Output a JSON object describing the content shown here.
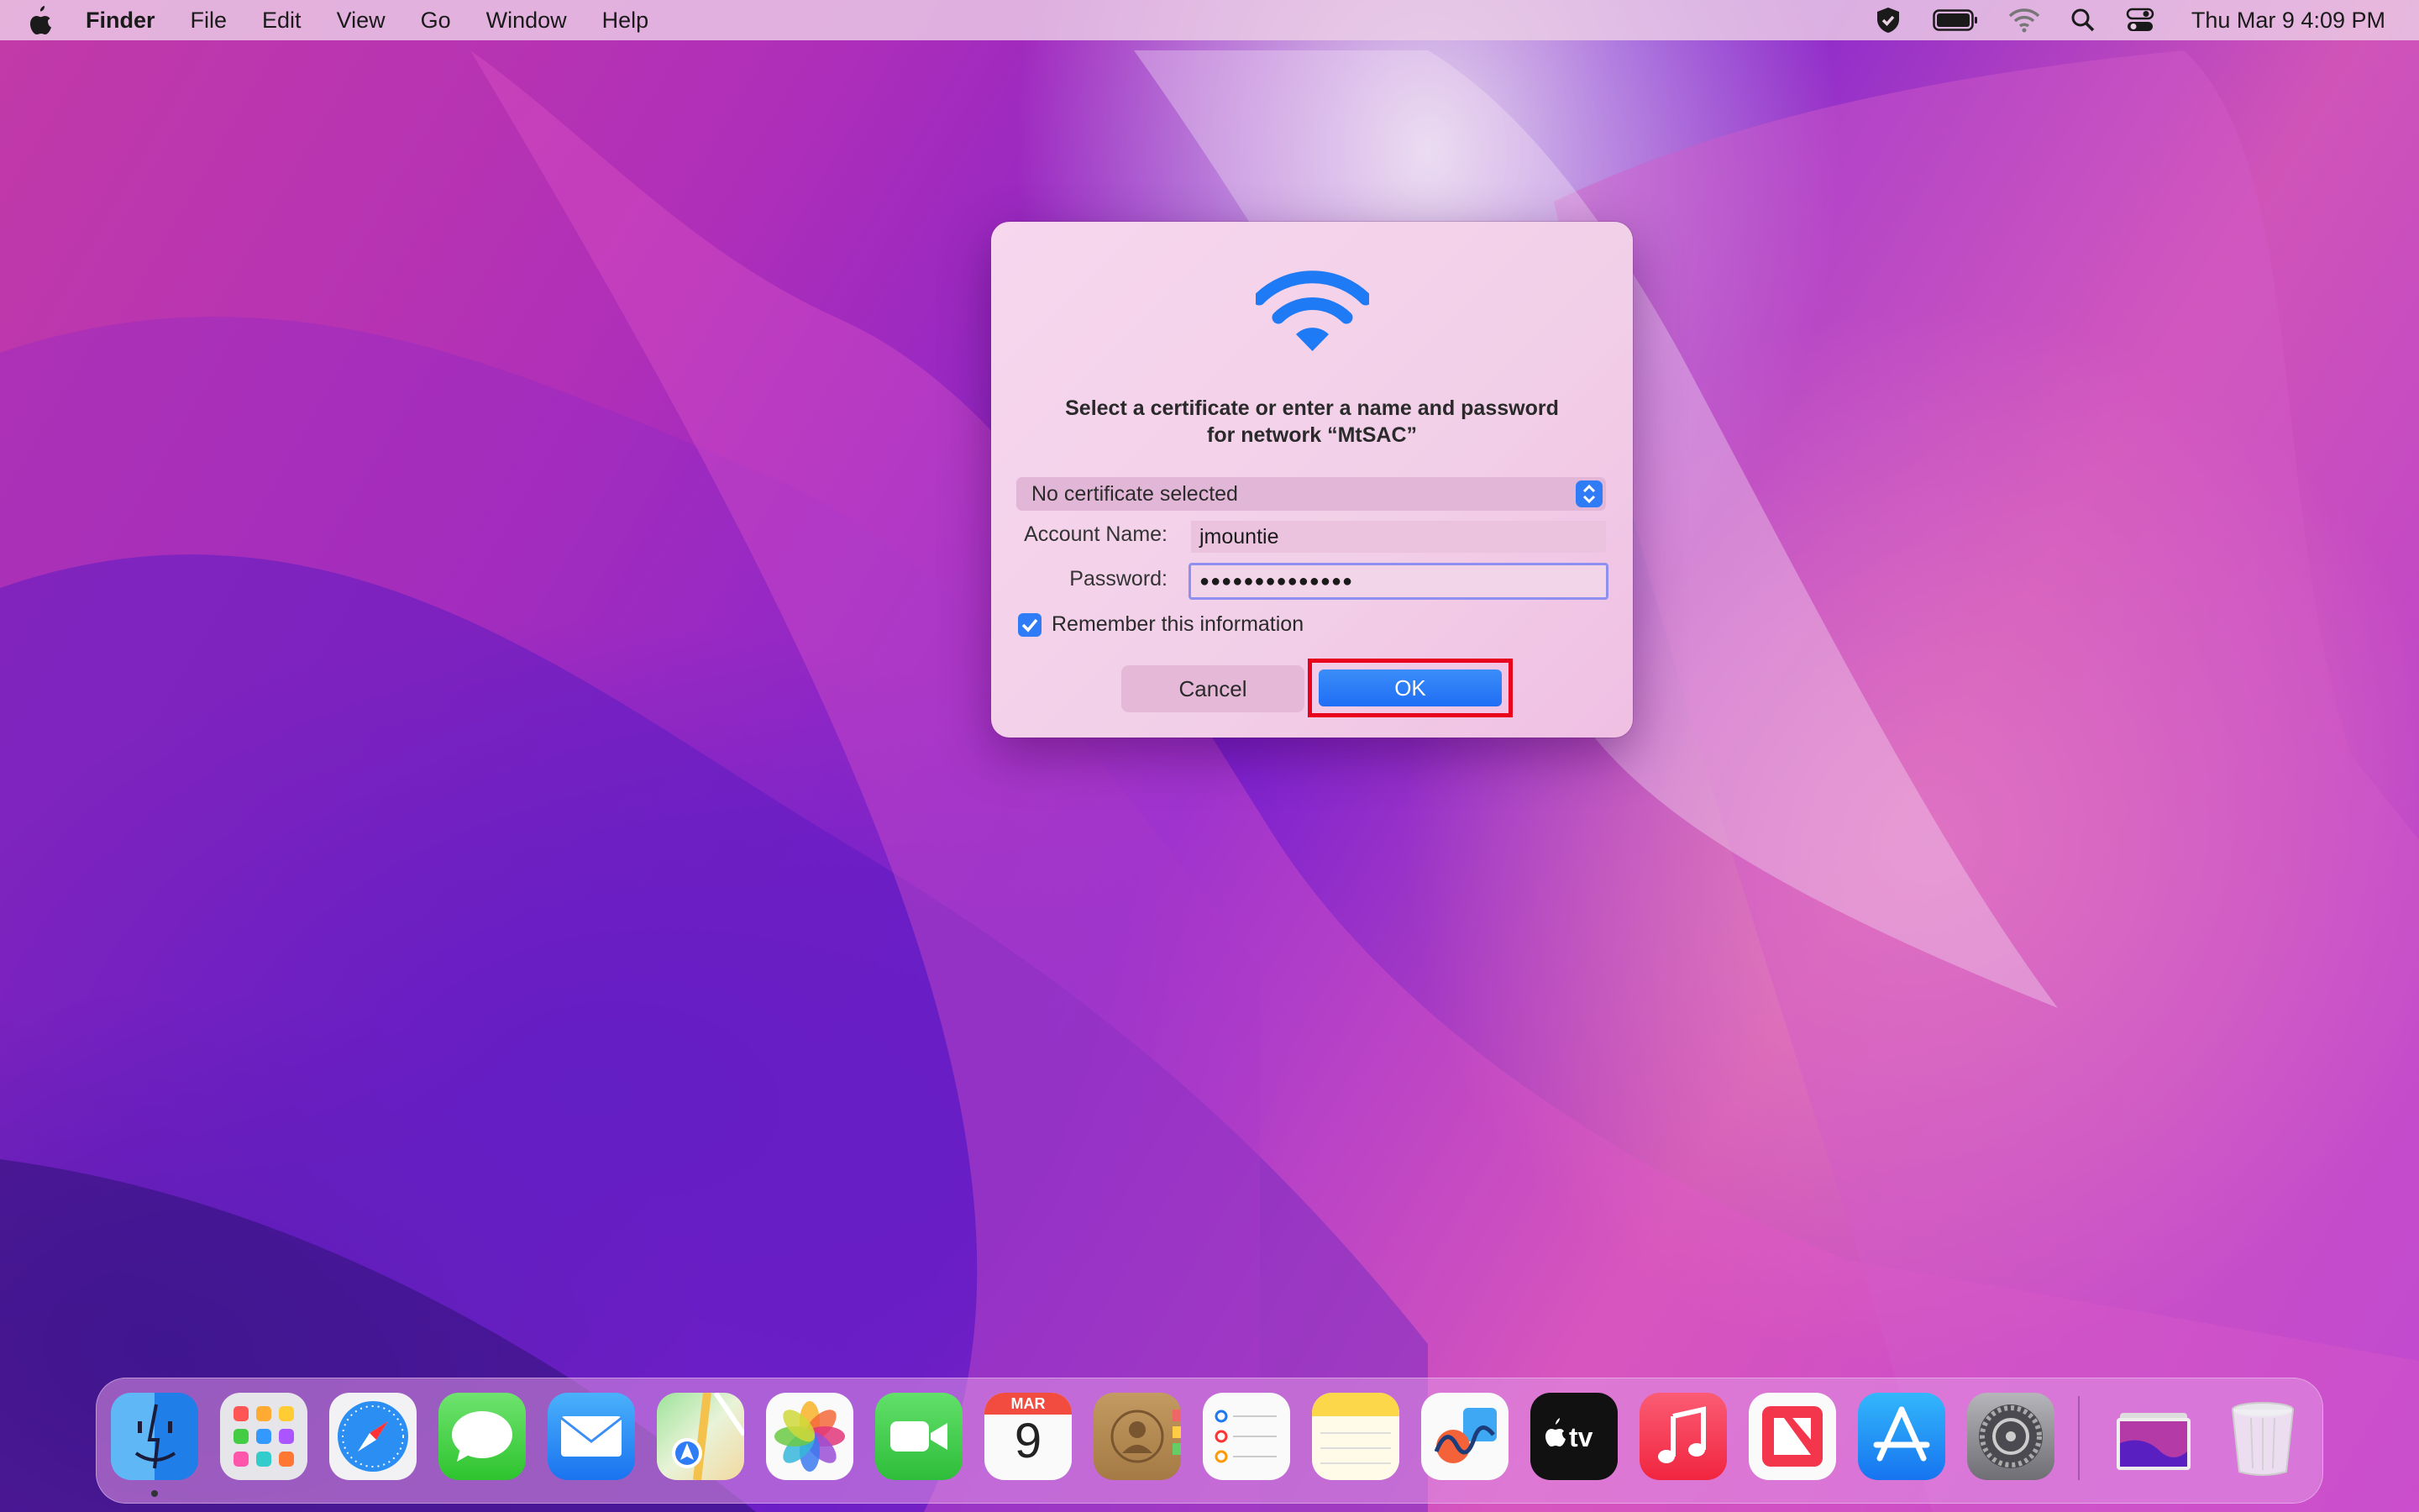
{
  "menubar": {
    "app_name": "Finder",
    "menus": [
      "File",
      "Edit",
      "View",
      "Go",
      "Window",
      "Help"
    ],
    "clock": "Thu Mar 9  4:09 PM"
  },
  "dialog": {
    "icon": "wifi-icon",
    "prompt_line1": "Select a certificate or enter a name and password",
    "prompt_line2": "for network “MtSAC”",
    "certificate_value": "No certificate selected",
    "account_label": "Account Name:",
    "account_value": "jmountie",
    "password_label": "Password:",
    "password_value": "●●●●●●●●●●●●●●",
    "remember_label": "Remember this information",
    "remember_checked": true,
    "cancel_label": "Cancel",
    "ok_label": "OK"
  },
  "dock": {
    "calendar_month": "MAR",
    "calendar_day": "9",
    "apps": [
      "Finder",
      "Launchpad",
      "Safari",
      "Messages",
      "Mail",
      "Maps",
      "Photos",
      "FaceTime",
      "Calendar",
      "Contacts",
      "Reminders",
      "Notes",
      "Freeform",
      "TV",
      "Music",
      "News",
      "App Store",
      "System Settings",
      "Downloads",
      "Trash"
    ]
  },
  "colors": {
    "accent": "#2f7cf6",
    "highlight": "#e8001d"
  }
}
